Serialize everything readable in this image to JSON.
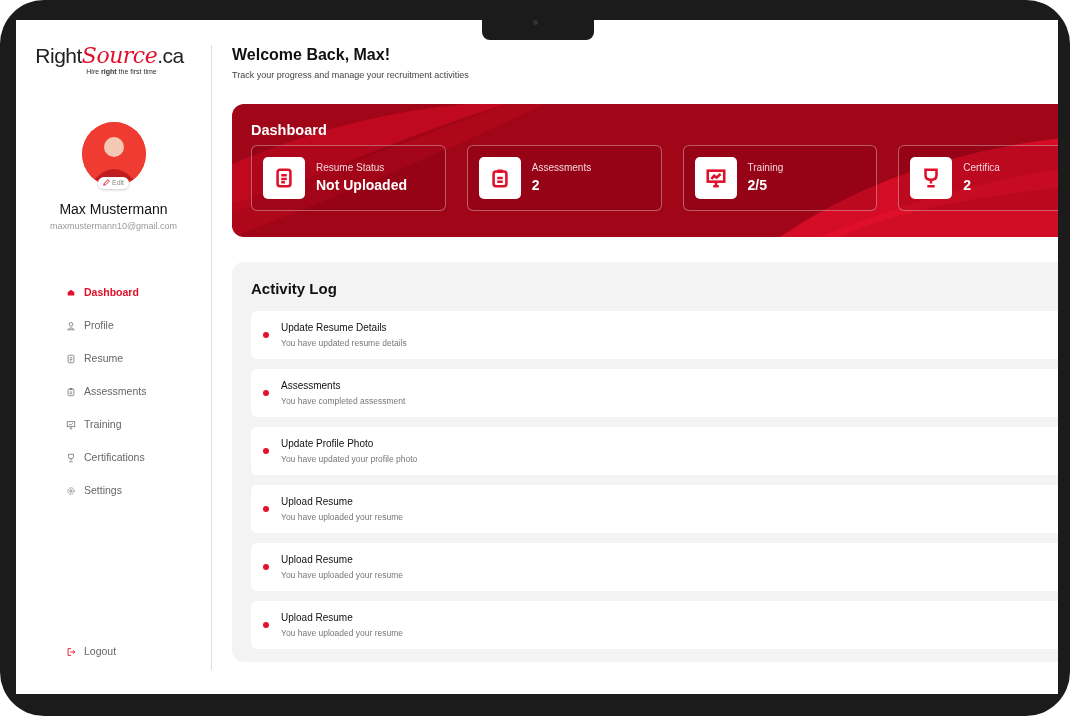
{
  "logo": {
    "part_1": "Right",
    "part_2": "Source",
    "part_3": ".ca",
    "tagline": "Hire **right** the first time"
  },
  "profile": {
    "edit_label": "Edit",
    "name": "Max Mustermann",
    "email": "maxmustermann10@gmail.com"
  },
  "sidebar": {
    "items": [
      {
        "label": "Dashboard",
        "kind": "home",
        "selected": true
      },
      {
        "label": "Profile",
        "kind": "user",
        "selected": false
      },
      {
        "label": "Resume",
        "kind": "doc",
        "selected": false
      },
      {
        "label": "Assessments",
        "kind": "clipboard",
        "selected": false
      },
      {
        "label": "Training",
        "kind": "board",
        "selected": false
      },
      {
        "label": "Certifications",
        "kind": "trophy",
        "selected": false
      },
      {
        "label": "Settings",
        "kind": "gear",
        "selected": false
      }
    ],
    "logout": "Logout"
  },
  "header": {
    "title": "Welcome Back, Max!",
    "subtitle": "Track your progress and manage your recruitment activities"
  },
  "dashboard": {
    "title": "Dashboard",
    "cards": [
      {
        "kind": "doc",
        "label": "Resume Status",
        "value": "Not Uploaded"
      },
      {
        "kind": "clipboard",
        "label": "Assessments",
        "value": "2"
      },
      {
        "kind": "board",
        "label": "Training",
        "value": "2/5"
      },
      {
        "kind": "trophy",
        "label": "Certifica",
        "value": "2"
      }
    ]
  },
  "activity_log": {
    "title": "Activity Log",
    "items": [
      {
        "title": "Update Resume Details",
        "detail": "You have updated resume details"
      },
      {
        "title": "Assessments",
        "detail": "You have completed assessment"
      },
      {
        "title": "Update Profile Photo",
        "detail": "You have updated your profile photo"
      },
      {
        "title": "Upload Resume",
        "detail": "You have uploaded your resume"
      },
      {
        "title": "Upload Resume",
        "detail": "You have uploaded your resume"
      },
      {
        "title": "Upload Resume",
        "detail": "You have uploaded your resume"
      }
    ]
  }
}
